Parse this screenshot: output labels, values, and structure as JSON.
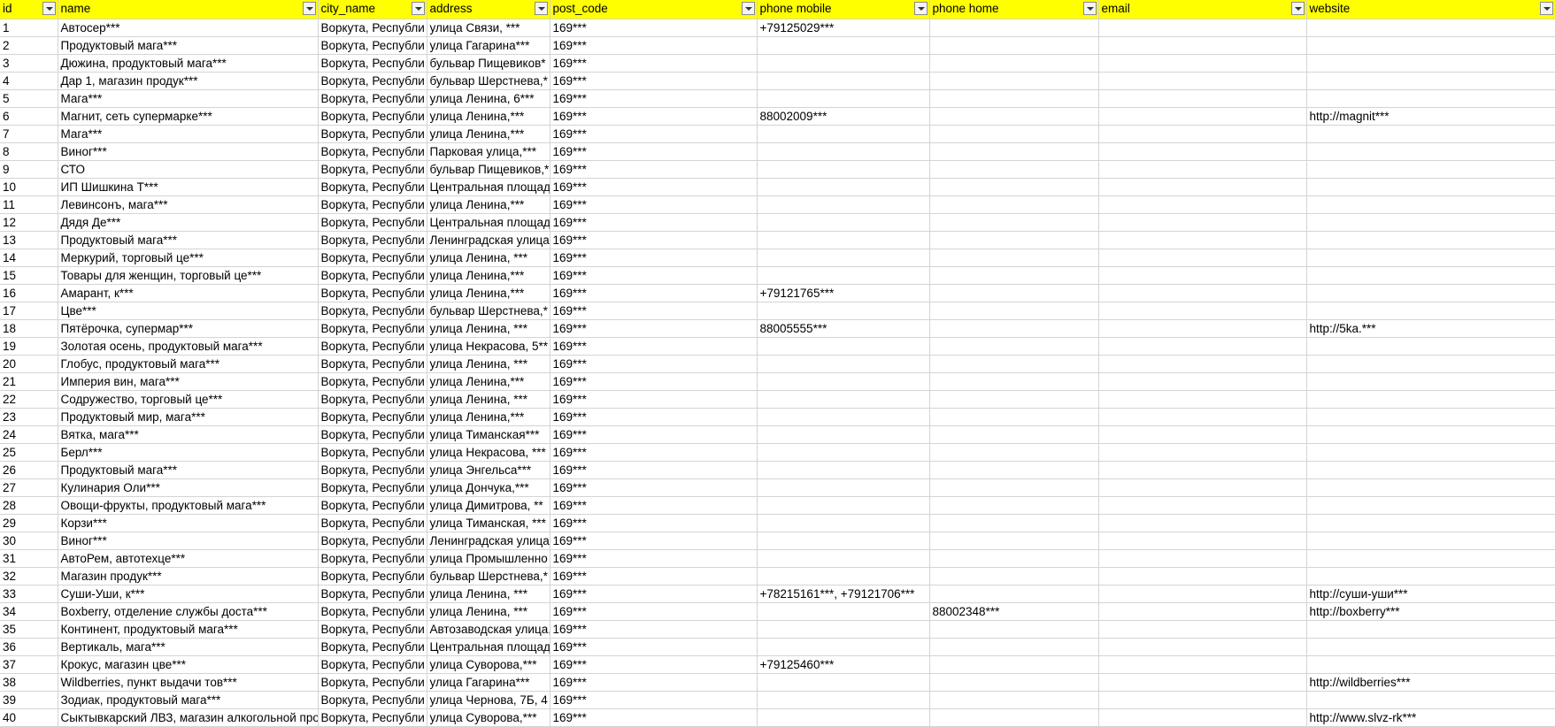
{
  "header": {
    "id": "id",
    "name": "name",
    "city_name": "city_name",
    "address": "address",
    "post_code": "post_code",
    "phone_mobile": "phone mobile",
    "phone_home": "phone home",
    "email": "email",
    "website": "website"
  },
  "accent": {
    "header_bg": "#ffff00",
    "grid": "#d4d4d4"
  },
  "rows": [
    {
      "id": "1",
      "name": "Автосер***",
      "city": "Воркута, Республи",
      "address": "улица Связи, ***",
      "post": "169***",
      "mobile": "+79125029***",
      "home": "",
      "email": "",
      "website": ""
    },
    {
      "id": "2",
      "name": "Продуктовый мага***",
      "city": "Воркута, Республи",
      "address": "улица Гагарина***",
      "post": "169***",
      "mobile": "",
      "home": "",
      "email": "",
      "website": ""
    },
    {
      "id": "3",
      "name": "Дюжина, продуктовый мага***",
      "city": "Воркута, Республи",
      "address": "бульвар Пищевиков*",
      "post": "169***",
      "mobile": "",
      "home": "",
      "email": "",
      "website": ""
    },
    {
      "id": "4",
      "name": "Дар 1, магазин продук***",
      "city": "Воркута, Республи",
      "address": "бульвар Шерстнева,*",
      "post": "169***",
      "mobile": "",
      "home": "",
      "email": "",
      "website": ""
    },
    {
      "id": "5",
      "name": "Мага***",
      "city": "Воркута, Республи",
      "address": "улица Ленина, 6***",
      "post": "169***",
      "mobile": "",
      "home": "",
      "email": "",
      "website": ""
    },
    {
      "id": "6",
      "name": "Магнит, сеть супермарке***",
      "city": "Воркута, Республи",
      "address": "улица Ленина,***",
      "post": "169***",
      "mobile": "88002009***",
      "home": "",
      "email": "",
      "website": "http://magnit***"
    },
    {
      "id": "7",
      "name": "Мага***",
      "city": "Воркута, Республи",
      "address": "улица Ленина,***",
      "post": "169***",
      "mobile": "",
      "home": "",
      "email": "",
      "website": ""
    },
    {
      "id": "8",
      "name": "Виног***",
      "city": "Воркута, Республи",
      "address": "Парковая улица,***",
      "post": "169***",
      "mobile": "",
      "home": "",
      "email": "",
      "website": ""
    },
    {
      "id": "9",
      "name": "СТО",
      "city": "Воркута, Республи",
      "address": "бульвар Пищевиков,*",
      "post": "169***",
      "mobile": "",
      "home": "",
      "email": "",
      "website": ""
    },
    {
      "id": "10",
      "name": "ИП Шишкина Т***",
      "city": "Воркута, Республи",
      "address": "Центральная площад",
      "post": "169***",
      "mobile": "",
      "home": "",
      "email": "",
      "website": ""
    },
    {
      "id": "11",
      "name": "Левинсонъ, мага***",
      "city": "Воркута, Республи",
      "address": "улица Ленина,***",
      "post": "169***",
      "mobile": "",
      "home": "",
      "email": "",
      "website": ""
    },
    {
      "id": "12",
      "name": "Дядя Де***",
      "city": "Воркута, Республи",
      "address": "Центральная площад",
      "post": "169***",
      "mobile": "",
      "home": "",
      "email": "",
      "website": ""
    },
    {
      "id": "13",
      "name": "Продуктовый мага***",
      "city": "Воркута, Республи",
      "address": "Ленинградская улица",
      "post": "169***",
      "mobile": "",
      "home": "",
      "email": "",
      "website": ""
    },
    {
      "id": "14",
      "name": "Меркурий, торговый це***",
      "city": "Воркута, Республи",
      "address": "улица Ленина, ***",
      "post": "169***",
      "mobile": "",
      "home": "",
      "email": "",
      "website": ""
    },
    {
      "id": "15",
      "name": "Товары для женщин, торговый це***",
      "city": "Воркута, Республи",
      "address": "улица Ленина,***",
      "post": "169***",
      "mobile": "",
      "home": "",
      "email": "",
      "website": ""
    },
    {
      "id": "16",
      "name": "Амарант, к***",
      "city": "Воркута, Республи",
      "address": "улица Ленина,***",
      "post": "169***",
      "mobile": "+79121765***",
      "home": "",
      "email": "",
      "website": ""
    },
    {
      "id": "17",
      "name": "Цве***",
      "city": "Воркута, Республи",
      "address": "бульвар Шерстнева,*",
      "post": "169***",
      "mobile": "",
      "home": "",
      "email": "",
      "website": ""
    },
    {
      "id": "18",
      "name": "Пятёрочка, супермар***",
      "city": "Воркута, Республи",
      "address": "улица Ленина, ***",
      "post": "169***",
      "mobile": "88005555***",
      "home": "",
      "email": "",
      "website": "http://5ka.***"
    },
    {
      "id": "19",
      "name": "Золотая осень, продуктовый мага***",
      "city": "Воркута, Республи",
      "address": "улица Некрасова, 5**",
      "post": "169***",
      "mobile": "",
      "home": "",
      "email": "",
      "website": ""
    },
    {
      "id": "20",
      "name": "Глобус, продуктовый мага***",
      "city": "Воркута, Республи",
      "address": "улица Ленина, ***",
      "post": "169***",
      "mobile": "",
      "home": "",
      "email": "",
      "website": ""
    },
    {
      "id": "21",
      "name": "Империя вин, мага***",
      "city": "Воркута, Республи",
      "address": "улица Ленина,***",
      "post": "169***",
      "mobile": "",
      "home": "",
      "email": "",
      "website": ""
    },
    {
      "id": "22",
      "name": "Содружество, торговый це***",
      "city": "Воркута, Республи",
      "address": "улица Ленина, ***",
      "post": "169***",
      "mobile": "",
      "home": "",
      "email": "",
      "website": ""
    },
    {
      "id": "23",
      "name": "Продуктовый мир, мага***",
      "city": "Воркута, Республи",
      "address": "улица Ленина,***",
      "post": "169***",
      "mobile": "",
      "home": "",
      "email": "",
      "website": ""
    },
    {
      "id": "24",
      "name": "Вятка, мага***",
      "city": "Воркута, Республи",
      "address": "улица Тиманская***",
      "post": "169***",
      "mobile": "",
      "home": "",
      "email": "",
      "website": ""
    },
    {
      "id": "25",
      "name": "Берл***",
      "city": "Воркута, Республи",
      "address": "улица Некрасова, ***",
      "post": "169***",
      "mobile": "",
      "home": "",
      "email": "",
      "website": ""
    },
    {
      "id": "26",
      "name": "Продуктовый мага***",
      "city": "Воркута, Республи",
      "address": "улица Энгельса***",
      "post": "169***",
      "mobile": "",
      "home": "",
      "email": "",
      "website": ""
    },
    {
      "id": "27",
      "name": "Кулинария Оли***",
      "city": "Воркута, Республи",
      "address": "улица Дончука,***",
      "post": "169***",
      "mobile": "",
      "home": "",
      "email": "",
      "website": ""
    },
    {
      "id": "28",
      "name": "Овощи-фрукты, продуктовый мага***",
      "city": "Воркута, Республи",
      "address": "улица Димитрова, **",
      "post": "169***",
      "mobile": "",
      "home": "",
      "email": "",
      "website": ""
    },
    {
      "id": "29",
      "name": "Корзи***",
      "city": "Воркута, Республи",
      "address": "улица Тиманская, ***",
      "post": "169***",
      "mobile": "",
      "home": "",
      "email": "",
      "website": ""
    },
    {
      "id": "30",
      "name": "Виног***",
      "city": "Воркута, Республи",
      "address": "Ленинградская улица",
      "post": "169***",
      "mobile": "",
      "home": "",
      "email": "",
      "website": ""
    },
    {
      "id": "31",
      "name": "АвтоРем, автотехце***",
      "city": "Воркута, Республи",
      "address": "улица Промышленно",
      "post": "169***",
      "mobile": "",
      "home": "",
      "email": "",
      "website": ""
    },
    {
      "id": "32",
      "name": "Магазин продук***",
      "city": "Воркута, Республи",
      "address": "бульвар Шерстнева,*",
      "post": "169***",
      "mobile": "",
      "home": "",
      "email": "",
      "website": ""
    },
    {
      "id": "33",
      "name": "Суши-Уши, к***",
      "city": "Воркута, Республи",
      "address": "улица Ленина, ***",
      "post": "169***",
      "mobile": "+78215161***, +79121706***",
      "home": "",
      "email": "",
      "website": "http://суши-уши***"
    },
    {
      "id": "34",
      "name": "Boxberry, отделение службы доста***",
      "city": "Воркута, Республи",
      "address": "улица Ленина, ***",
      "post": "169***",
      "mobile": "",
      "home": "88002348***",
      "email": "",
      "website": "http://boxberry***"
    },
    {
      "id": "35",
      "name": "Континент, продуктовый мага***",
      "city": "Воркута, Республи",
      "address": "Автозаводская улица,",
      "post": "169***",
      "mobile": "",
      "home": "",
      "email": "",
      "website": ""
    },
    {
      "id": "36",
      "name": "Вертикаль, мага***",
      "city": "Воркута, Республи",
      "address": "Центральная площад",
      "post": "169***",
      "mobile": "",
      "home": "",
      "email": "",
      "website": ""
    },
    {
      "id": "37",
      "name": "Крокус, магазин цве***",
      "city": "Воркута, Республи",
      "address": "улица Суворова,***",
      "post": "169***",
      "mobile": "+79125460***",
      "home": "",
      "email": "",
      "website": ""
    },
    {
      "id": "38",
      "name": "Wildberries, пункт выдачи тов***",
      "city": "Воркута, Республи",
      "address": "улица Гагарина***",
      "post": "169***",
      "mobile": "",
      "home": "",
      "email": "",
      "website": "http://wildberries***"
    },
    {
      "id": "39",
      "name": "Зодиак, продуктовый мага***",
      "city": "Воркута, Республи",
      "address": "улица Чернова, 7Б, 4",
      "post": "169***",
      "mobile": "",
      "home": "",
      "email": "",
      "website": ""
    },
    {
      "id": "40",
      "name": "Сыктывкарский ЛВЗ, магазин алкогольной про",
      "city": "Воркута, Республи",
      "address": "улица Суворова,***",
      "post": "169***",
      "mobile": "",
      "home": "",
      "email": "",
      "website": "http://www.slvz-rk***"
    }
  ]
}
